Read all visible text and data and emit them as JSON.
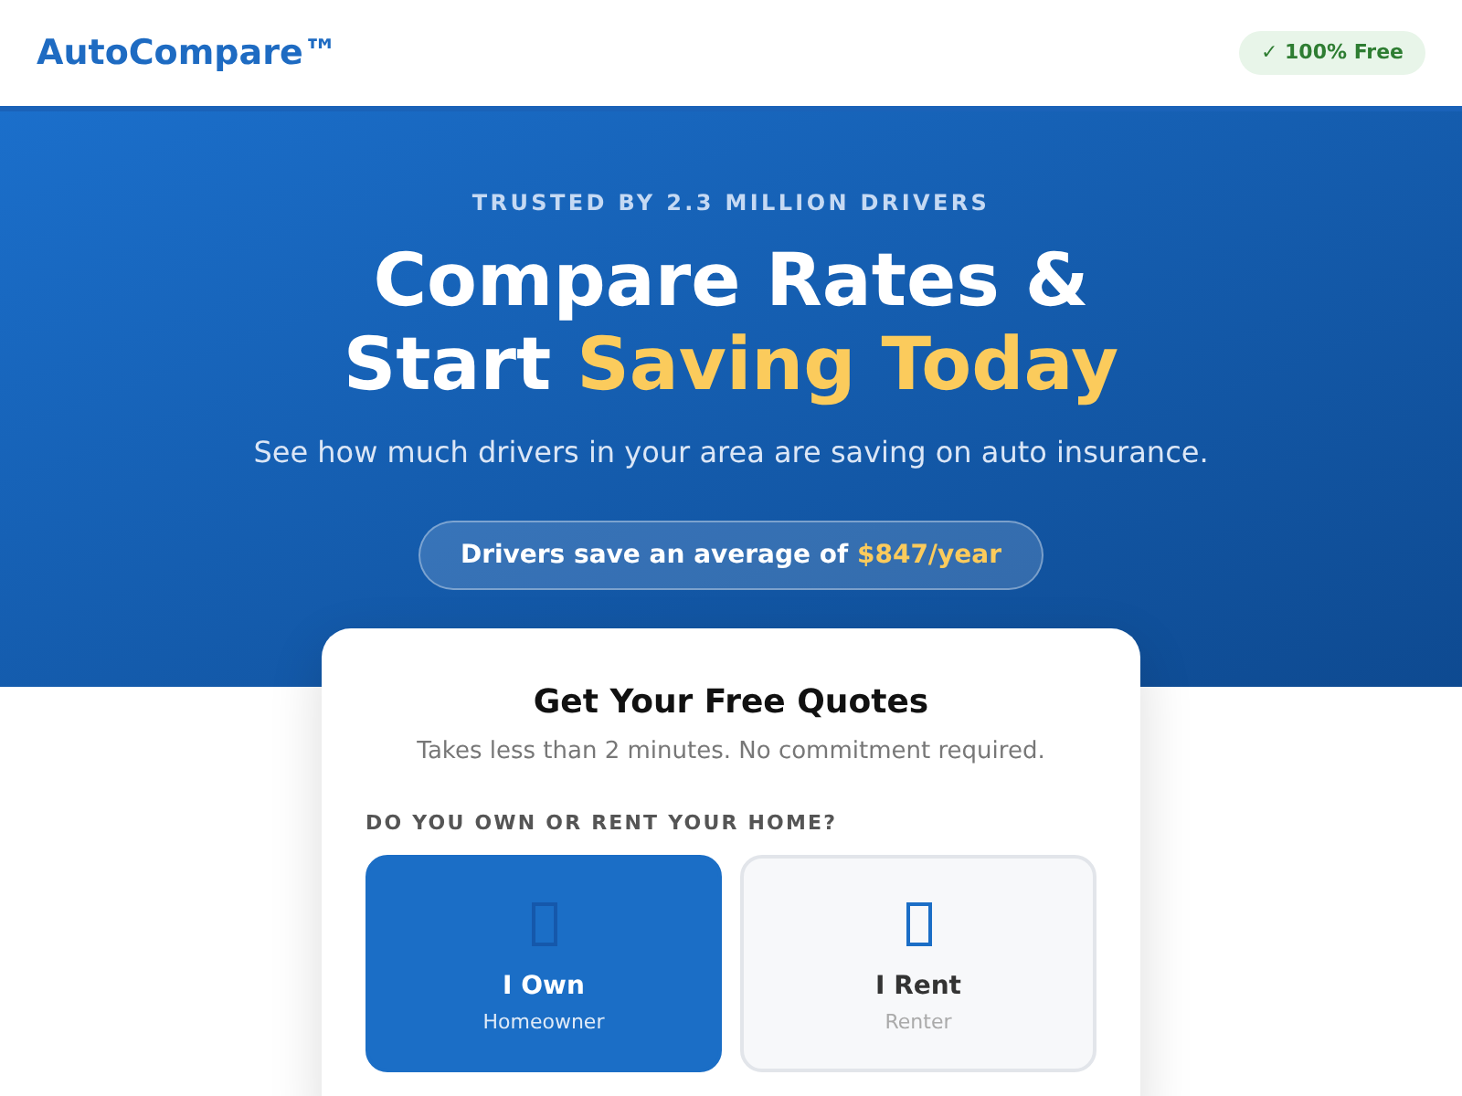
{
  "header": {
    "logo": "AutoCompare™",
    "badge": "✓ 100% Free"
  },
  "hero": {
    "eyebrow": "TRUSTED BY 2.3 MILLION DRIVERS",
    "title_lines": [
      [
        {
          "text": "Compare Rates &",
          "highlight": false
        }
      ],
      [
        {
          "text": "Start ",
          "highlight": false
        },
        {
          "text": "Saving Today",
          "highlight": true
        }
      ]
    ],
    "subtitle": "See how much drivers in your area are saving on auto insurance.",
    "savings_pill": [
      {
        "text": "Drivers save an average of ",
        "highlight": false
      },
      {
        "text": "$847/year",
        "highlight": true
      }
    ]
  },
  "quote_card": {
    "title": "Get Your Free Quotes",
    "subtitle": "Takes less than 2 minutes. No commitment required.",
    "question": "DO YOU OWN OR RENT YOUR HOME?",
    "options": [
      {
        "label": "I Own",
        "sublabel": "Homeowner",
        "selected": true
      },
      {
        "label": "I Rent",
        "sublabel": "Renter",
        "selected": false
      }
    ]
  }
}
